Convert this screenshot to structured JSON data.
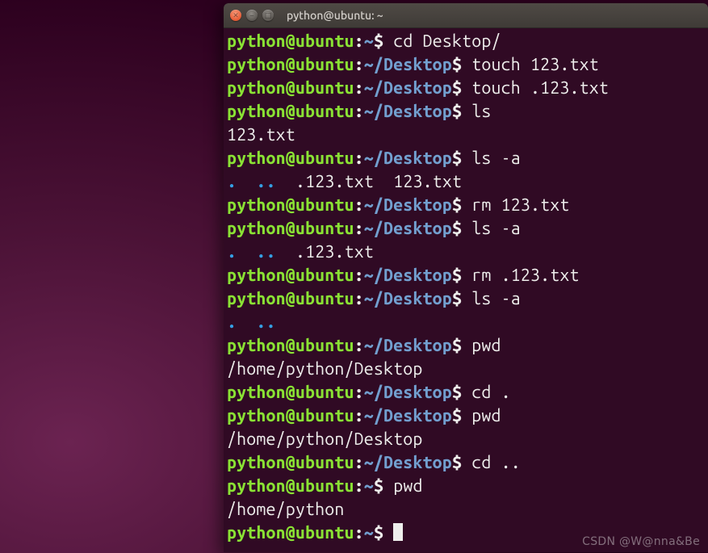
{
  "window": {
    "title": "python@ubuntu: ~"
  },
  "user_host": "python@ubuntu",
  "paths": {
    "home_short": "~",
    "desktop_short": "~/Desktop"
  },
  "lines": [
    {
      "t": "prompt",
      "path": "~",
      "cmd": "cd Desktop/"
    },
    {
      "t": "prompt",
      "path": "~/Desktop",
      "cmd": "touch 123.txt"
    },
    {
      "t": "prompt",
      "path": "~/Desktop",
      "cmd": "touch .123.txt"
    },
    {
      "t": "prompt",
      "path": "~/Desktop",
      "cmd": "ls"
    },
    {
      "t": "out",
      "text": "123.txt"
    },
    {
      "t": "prompt",
      "path": "~/Desktop",
      "cmd": "ls -a"
    },
    {
      "t": "ls_a",
      "dirs": [
        ".",
        ".."
      ],
      "files": [
        ".123.txt",
        "123.txt"
      ]
    },
    {
      "t": "prompt",
      "path": "~/Desktop",
      "cmd": "rm 123.txt"
    },
    {
      "t": "prompt",
      "path": "~/Desktop",
      "cmd": "ls -a"
    },
    {
      "t": "ls_a",
      "dirs": [
        ".",
        ".."
      ],
      "files": [
        ".123.txt"
      ]
    },
    {
      "t": "prompt",
      "path": "~/Desktop",
      "cmd": "rm .123.txt"
    },
    {
      "t": "prompt",
      "path": "~/Desktop",
      "cmd": "ls -a"
    },
    {
      "t": "ls_a",
      "dirs": [
        ".",
        ".."
      ],
      "files": []
    },
    {
      "t": "prompt",
      "path": "~/Desktop",
      "cmd": "pwd"
    },
    {
      "t": "out",
      "text": "/home/python/Desktop"
    },
    {
      "t": "prompt",
      "path": "~/Desktop",
      "cmd": "cd ."
    },
    {
      "t": "prompt",
      "path": "~/Desktop",
      "cmd": "pwd"
    },
    {
      "t": "out",
      "text": "/home/python/Desktop"
    },
    {
      "t": "prompt",
      "path": "~/Desktop",
      "cmd": "cd .."
    },
    {
      "t": "prompt",
      "path": "~",
      "cmd": "pwd"
    },
    {
      "t": "out",
      "text": "/home/python"
    },
    {
      "t": "prompt",
      "path": "~",
      "cmd": "",
      "cursor": true
    }
  ],
  "buttons": {
    "close_glyph": "✕",
    "min_glyph": "–",
    "max_glyph": "□"
  },
  "watermark": "CSDN @W@nna&Be"
}
